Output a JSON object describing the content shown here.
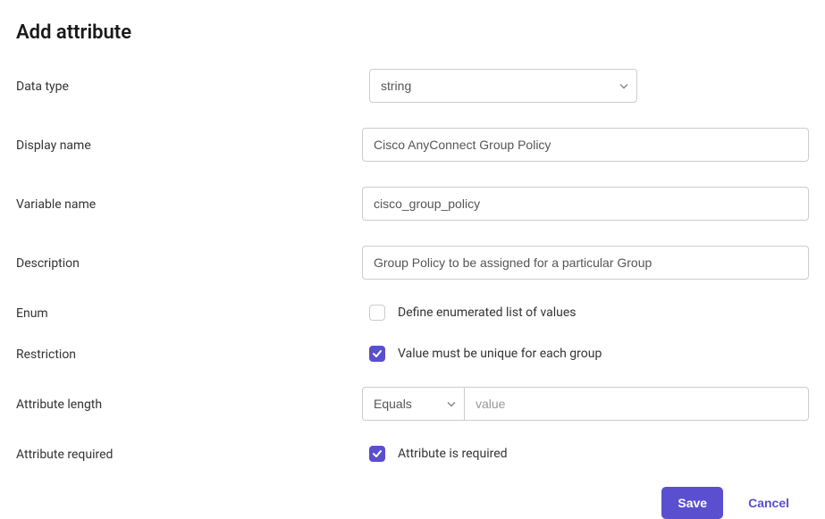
{
  "title": "Add attribute",
  "labels": {
    "data_type": "Data type",
    "display_name": "Display name",
    "variable_name": "Variable name",
    "description": "Description",
    "enum": "Enum",
    "restriction": "Restriction",
    "attribute_length": "Attribute length",
    "attribute_required": "Attribute required"
  },
  "values": {
    "data_type": "string",
    "display_name": "Cisco AnyConnect Group Policy",
    "variable_name": "cisco_group_policy",
    "description": "Group Policy to be assigned for a particular Group",
    "enum_label": "Define enumerated list of values",
    "enum_checked": false,
    "restriction_label": "Value must be unique for each group",
    "restriction_checked": true,
    "length_operator": "Equals",
    "length_value_placeholder": "value",
    "required_label": "Attribute is required",
    "required_checked": true
  },
  "buttons": {
    "save": "Save",
    "cancel": "Cancel"
  }
}
